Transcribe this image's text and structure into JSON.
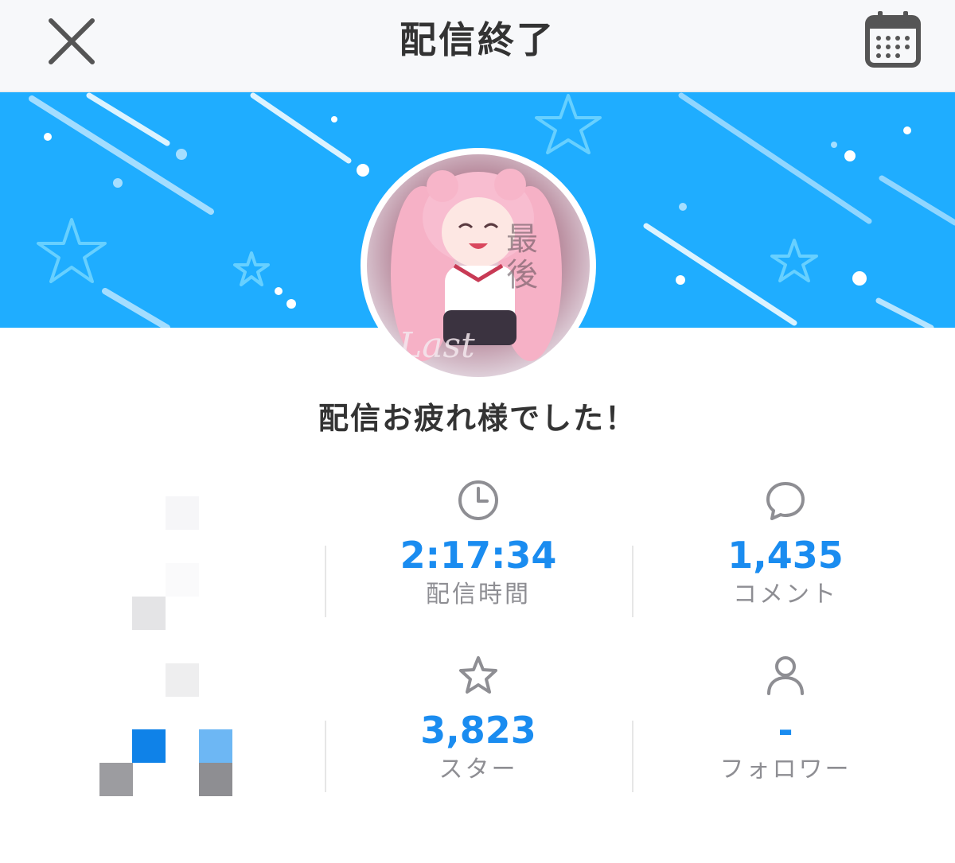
{
  "header": {
    "title": "配信終了",
    "close_icon": "close-icon",
    "calendar_icon": "calendar-icon"
  },
  "message": "配信お疲れ様でした！",
  "stats": [
    {
      "icon": "clock-icon",
      "value": "2:17:34",
      "label": "配信時間"
    },
    {
      "icon": "comment-icon",
      "value": "1,435",
      "label": "コメント"
    },
    {
      "icon": "star-icon",
      "value": "3,823",
      "label": "スター"
    },
    {
      "icon": "person-icon",
      "value": "-",
      "label": "フォロワー"
    }
  ],
  "colors": {
    "banner": "#1fadff",
    "accent": "#1a8cf0",
    "label": "#8e8e93"
  }
}
